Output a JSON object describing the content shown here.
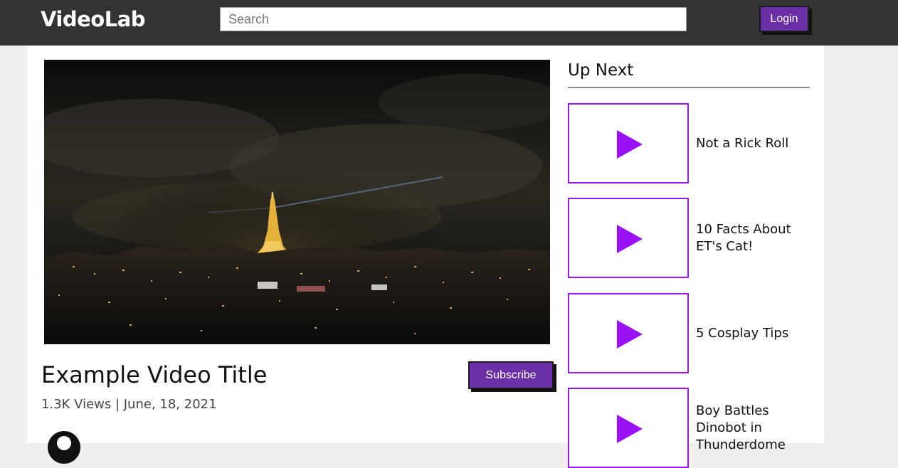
{
  "header": {
    "logo": "VideoLab",
    "search_placeholder": "Search",
    "login_label": "Login"
  },
  "video": {
    "title": "Example Video Title",
    "meta": "1.3K Views | June, 18, 2021",
    "subscribe_label": "Subscribe"
  },
  "upnext": {
    "heading": "Up Next",
    "items": [
      {
        "title": "Not a Rick Roll",
        "icon": "play-icon"
      },
      {
        "title": "10 Facts About ET's Cat!",
        "icon": "play-icon"
      },
      {
        "title": "5 Cosplay Tips",
        "icon": "play-icon"
      },
      {
        "title": "Boy Battles Dinobot in Thunderdome",
        "icon": "play-icon"
      }
    ]
  },
  "colors": {
    "header_bg": "#333333",
    "accent_purple": "#6a2fa5",
    "play_purple": "#9b11f5"
  }
}
